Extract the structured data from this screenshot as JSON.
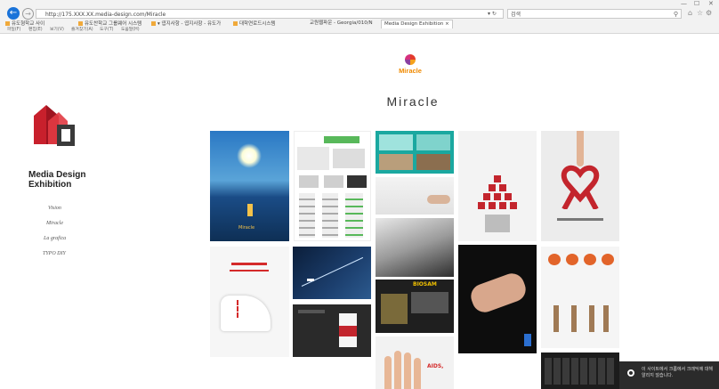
{
  "browser": {
    "url": "http://175.XXX.XX.media-design.com/Miracle",
    "address_icons": "▾ ↻",
    "search_placeholder": "검색",
    "win_controls": [
      "—",
      "☐",
      "✕"
    ],
    "favorites": [
      "유도형학교 사이",
      "유도찬학교 그룹웨어 시스템",
      "▾ 엽지사항 - 엽지사항 - 유도가",
      "대학연로드시스템"
    ],
    "tabs": [
      "교원웹파운 - Georgia/010/N",
      "Media Design Exhibition"
    ],
    "menu": [
      "파일(F)",
      "편집(E)",
      "보기(V)",
      "즐겨찾기(A)",
      "도구(T)",
      "도움말(H)"
    ]
  },
  "sidebar": {
    "brand_line1": "Media Design",
    "brand_line2": "Exhibition",
    "links": [
      "Vision",
      "Miracle",
      "La grafica",
      "TYPO DIY"
    ]
  },
  "main": {
    "logo_text": "Miracle",
    "title": "Miracle"
  },
  "gallery": {
    "tiles": [
      {
        "name": "poster-sun-sea",
        "caption": "Miracle"
      },
      {
        "name": "poster-ui-sketches",
        "caption": ""
      },
      {
        "name": "poster-teal-scenes",
        "caption": ""
      },
      {
        "name": "poster-hand-wall",
        "caption": ""
      },
      {
        "name": "poster-hands-dark",
        "caption": ""
      },
      {
        "name": "poster-pictogram-pyramid",
        "caption": ""
      },
      {
        "name": "poster-red-ribbon",
        "caption": ""
      },
      {
        "name": "poster-white-sneaker",
        "caption": ""
      },
      {
        "name": "poster-airplane",
        "caption": ""
      },
      {
        "name": "poster-coffee-cup",
        "caption": ""
      },
      {
        "name": "poster-biosam",
        "caption": "BIOSAM"
      },
      {
        "name": "poster-clasped-hands",
        "caption": ""
      },
      {
        "name": "poster-persimmons",
        "caption": ""
      },
      {
        "name": "poster-finger-faces",
        "caption": "AIDS,"
      },
      {
        "name": "poster-keyboard",
        "caption": ""
      }
    ]
  },
  "toast": {
    "text": "이 사이트에서 크롬에서 크래딕에 대해 알리지 않습니다."
  },
  "colors": {
    "accent": "#1a73d9",
    "logo_red": "#c8202c",
    "logo_dark": "#3a3a3a"
  }
}
